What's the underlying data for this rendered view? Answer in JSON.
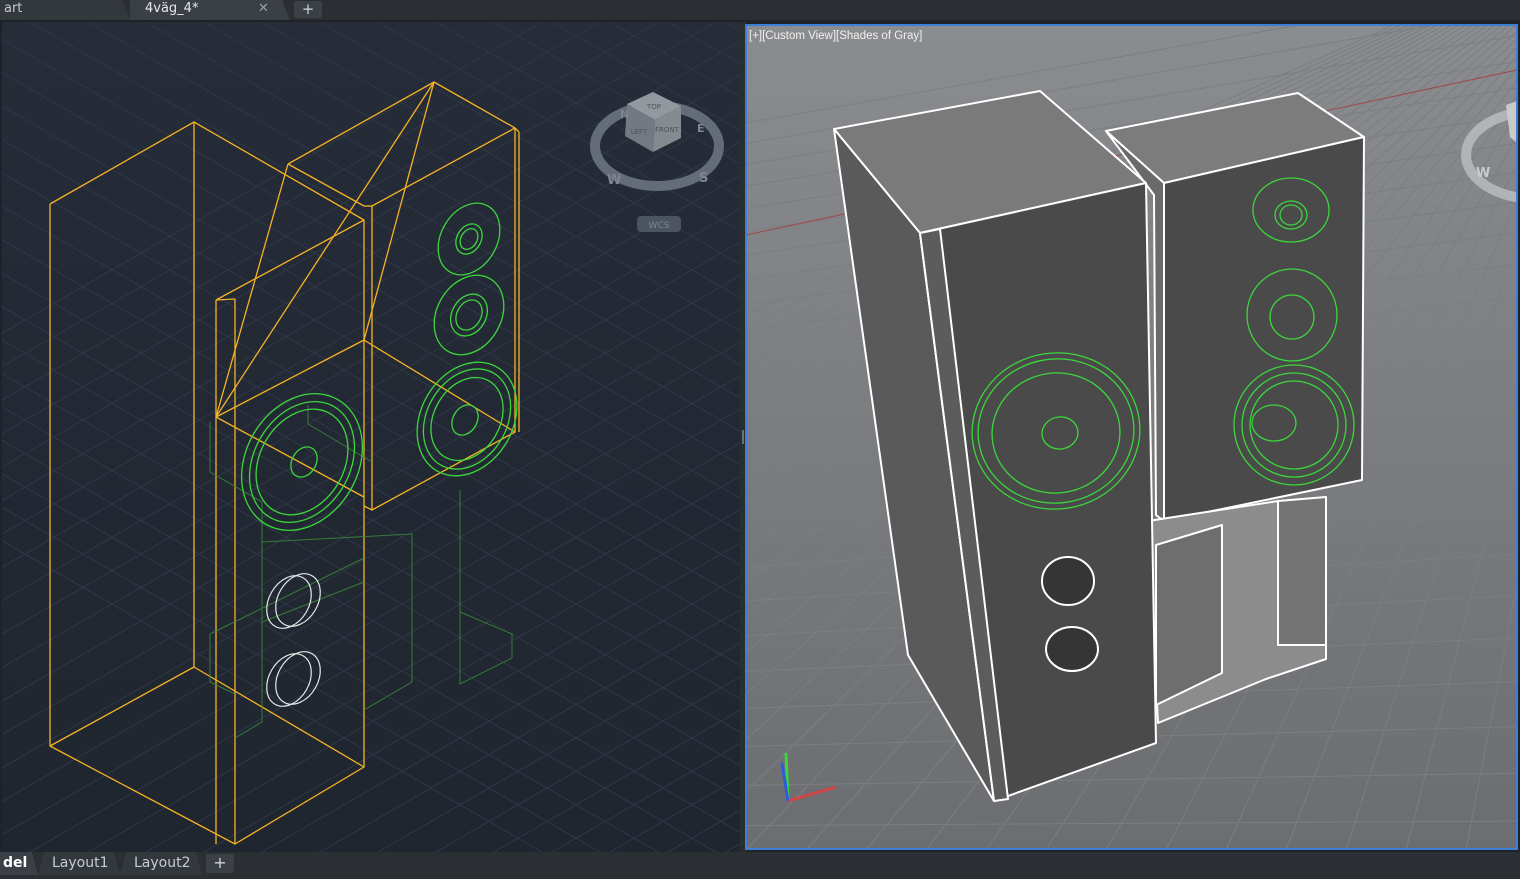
{
  "document_tabs": {
    "start_label": "art",
    "active_label": "4väg_4*",
    "close_glyph": "✕",
    "new_tab_glyph": "+"
  },
  "left_viewport": {
    "visual_style": "wireframe",
    "viewcube": {
      "top": "TOP",
      "left": "LEFT",
      "front": "FRONT",
      "compass": {
        "north": "N",
        "south": "S",
        "west": "W",
        "east": "E"
      },
      "wcs_label": "WCS"
    }
  },
  "right_viewport": {
    "label": "[+][Custom View][Shades of Gray]",
    "viewcube": {
      "west": "W"
    }
  },
  "layout_tabs": {
    "model_label": "del",
    "layout1_label": "Layout1",
    "layout2_label": "Layout2",
    "new_tab_glyph": "+"
  },
  "colors": {
    "wire_yellow": "#f5b324",
    "driver_green": "#3cd63c",
    "left_bg": "#232a35",
    "right_bg_top": "#87898c",
    "right_bg_bottom": "#6d6f72",
    "active_border": "#3b7fd6"
  }
}
